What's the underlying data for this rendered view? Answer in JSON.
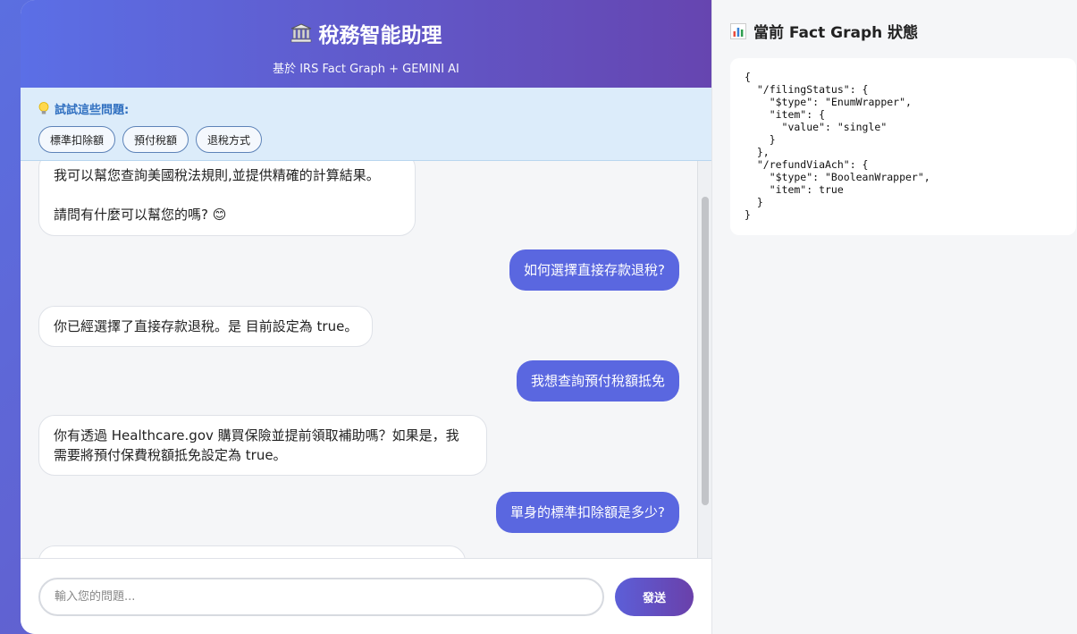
{
  "header": {
    "title": "稅務智能助理",
    "subtitle": "基於 IRS Fact Graph + GEMINI AI"
  },
  "suggestions": {
    "heading": "試試這些問題:",
    "chips": [
      "標準扣除額",
      "預付稅額",
      "退稅方式"
    ]
  },
  "messages": [
    {
      "role": "ai",
      "text_1": "我可以幫您查詢美國稅法規則,並提供精確的計算結果。",
      "text_2": "請問有什麼可以幫您的嗎? 😊"
    },
    {
      "role": "user",
      "text": "如何選擇直接存款退稅?"
    },
    {
      "role": "ai",
      "text": "你已經選擇了直接存款退稅。是 目前設定為 true。"
    },
    {
      "role": "user",
      "text": "我想查詢預付稅額抵免"
    },
    {
      "role": "ai",
      "text": "你有透過 Healthcare.gov 購買保險並提前領取補助嗎？如果是，我需要將預付保費稅額抵免設定為 true。"
    },
    {
      "role": "user",
      "text": "單身的標準扣除額是多少?"
    }
  ],
  "input": {
    "placeholder": "輸入您的問題...",
    "send_label": "發送"
  },
  "side": {
    "title": "當前 Fact Graph 狀態",
    "json_text": "{\n  \"/filingStatus\": {\n    \"$type\": \"EnumWrapper\",\n    \"item\": {\n      \"value\": \"single\"\n    }\n  },\n  \"/refundViaAch\": {\n    \"$type\": \"BooleanWrapper\",\n    \"item\": true\n  }\n}"
  }
}
